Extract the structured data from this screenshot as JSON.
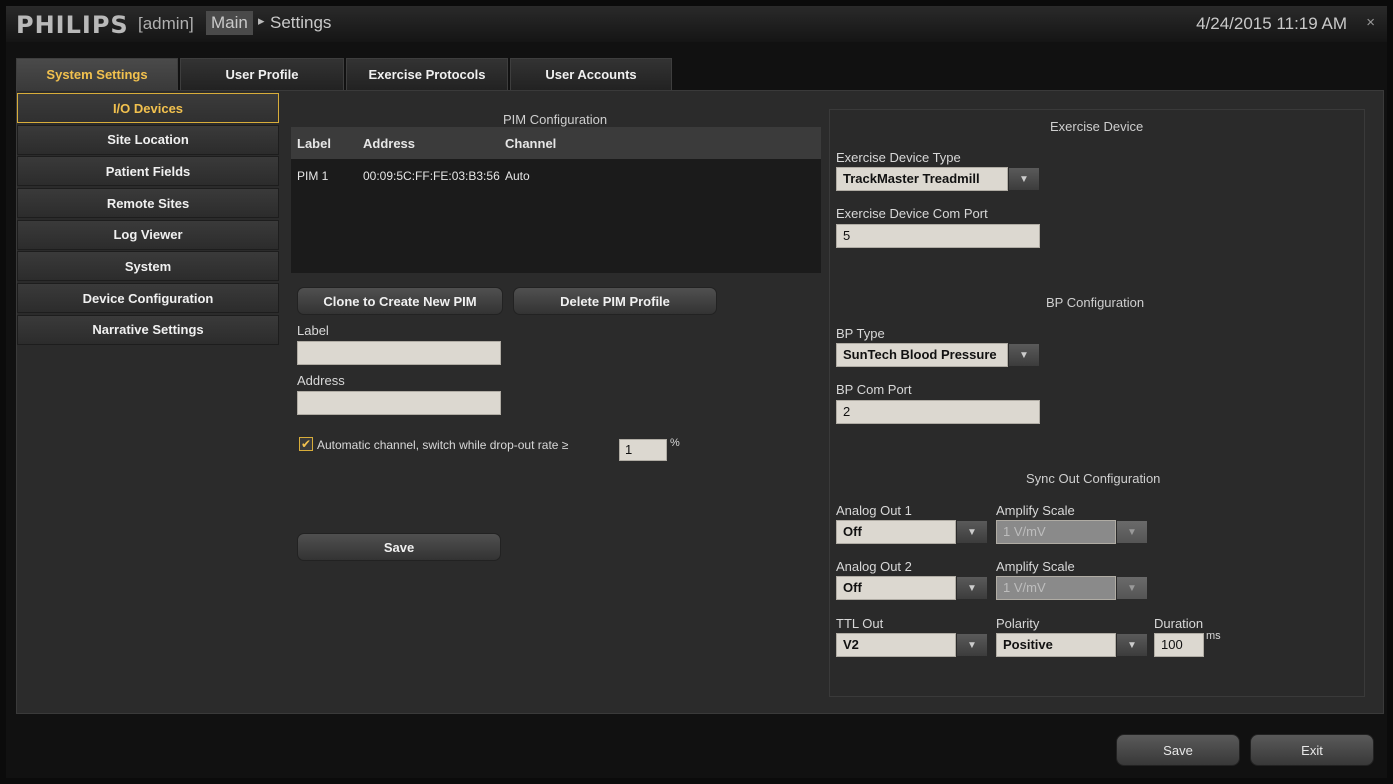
{
  "header": {
    "brand": "PHILIPS",
    "user": "[admin]",
    "crumb_main": "Main",
    "crumb_sep": "▸",
    "crumb_current": "Settings",
    "datetime": "4/24/2015 11:19 AM",
    "close": "×"
  },
  "tabs": [
    {
      "label": "System Settings",
      "active": true
    },
    {
      "label": "User Profile"
    },
    {
      "label": "Exercise Protocols"
    },
    {
      "label": "User Accounts"
    }
  ],
  "nav": [
    {
      "label": "I/O Devices",
      "active": true
    },
    {
      "label": "Site Location"
    },
    {
      "label": "Patient Fields"
    },
    {
      "label": "Remote Sites"
    },
    {
      "label": "Log Viewer"
    },
    {
      "label": "System"
    },
    {
      "label": "Device Configuration"
    },
    {
      "label": "Narrative Settings"
    }
  ],
  "pim": {
    "title": "PIM Configuration",
    "columns": [
      "Label",
      "Address",
      "Channel"
    ],
    "rows": [
      {
        "label": "PIM 1",
        "address": "00:09:5C:FF:FE:03:B3:56",
        "channel": "Auto"
      }
    ],
    "clone_button": "Clone to Create New PIM",
    "delete_button": "Delete PIM Profile",
    "label_field_label": "Label",
    "label_value": "",
    "address_field_label": "Address",
    "address_value": "",
    "auto_channel_label": "Automatic channel, switch while drop-out rate ≥",
    "auto_channel_checked": true,
    "dropout_value": "1",
    "percent": "%",
    "save_button": "Save"
  },
  "exercise_device": {
    "title": "Exercise Device",
    "type_label": "Exercise Device Type",
    "type_value": "TrackMaster Treadmill",
    "port_label": "Exercise Device Com Port",
    "port_value": "5"
  },
  "bp": {
    "title": "BP Configuration",
    "type_label": "BP Type",
    "type_value": "SunTech Blood Pressure",
    "port_label": "BP Com Port",
    "port_value": "2"
  },
  "sync": {
    "title": "Sync Out Configuration",
    "analog1_label": "Analog Out 1",
    "analog1_value": "Off",
    "amp1_label": "Amplify Scale",
    "amp1_value": "1 V/mV",
    "analog2_label": "Analog Out 2",
    "analog2_value": "Off",
    "amp2_label": "Amplify Scale",
    "amp2_value": "1 V/mV",
    "ttl_label": "TTL Out",
    "ttl_value": "V2",
    "polarity_label": "Polarity",
    "polarity_value": "Positive",
    "duration_label": "Duration",
    "duration_value": "100",
    "duration_unit": "ms"
  },
  "footer": {
    "save_button": "Save",
    "exit_button": "Exit"
  },
  "icons": {
    "dropdown": "▼",
    "check": "✔"
  }
}
